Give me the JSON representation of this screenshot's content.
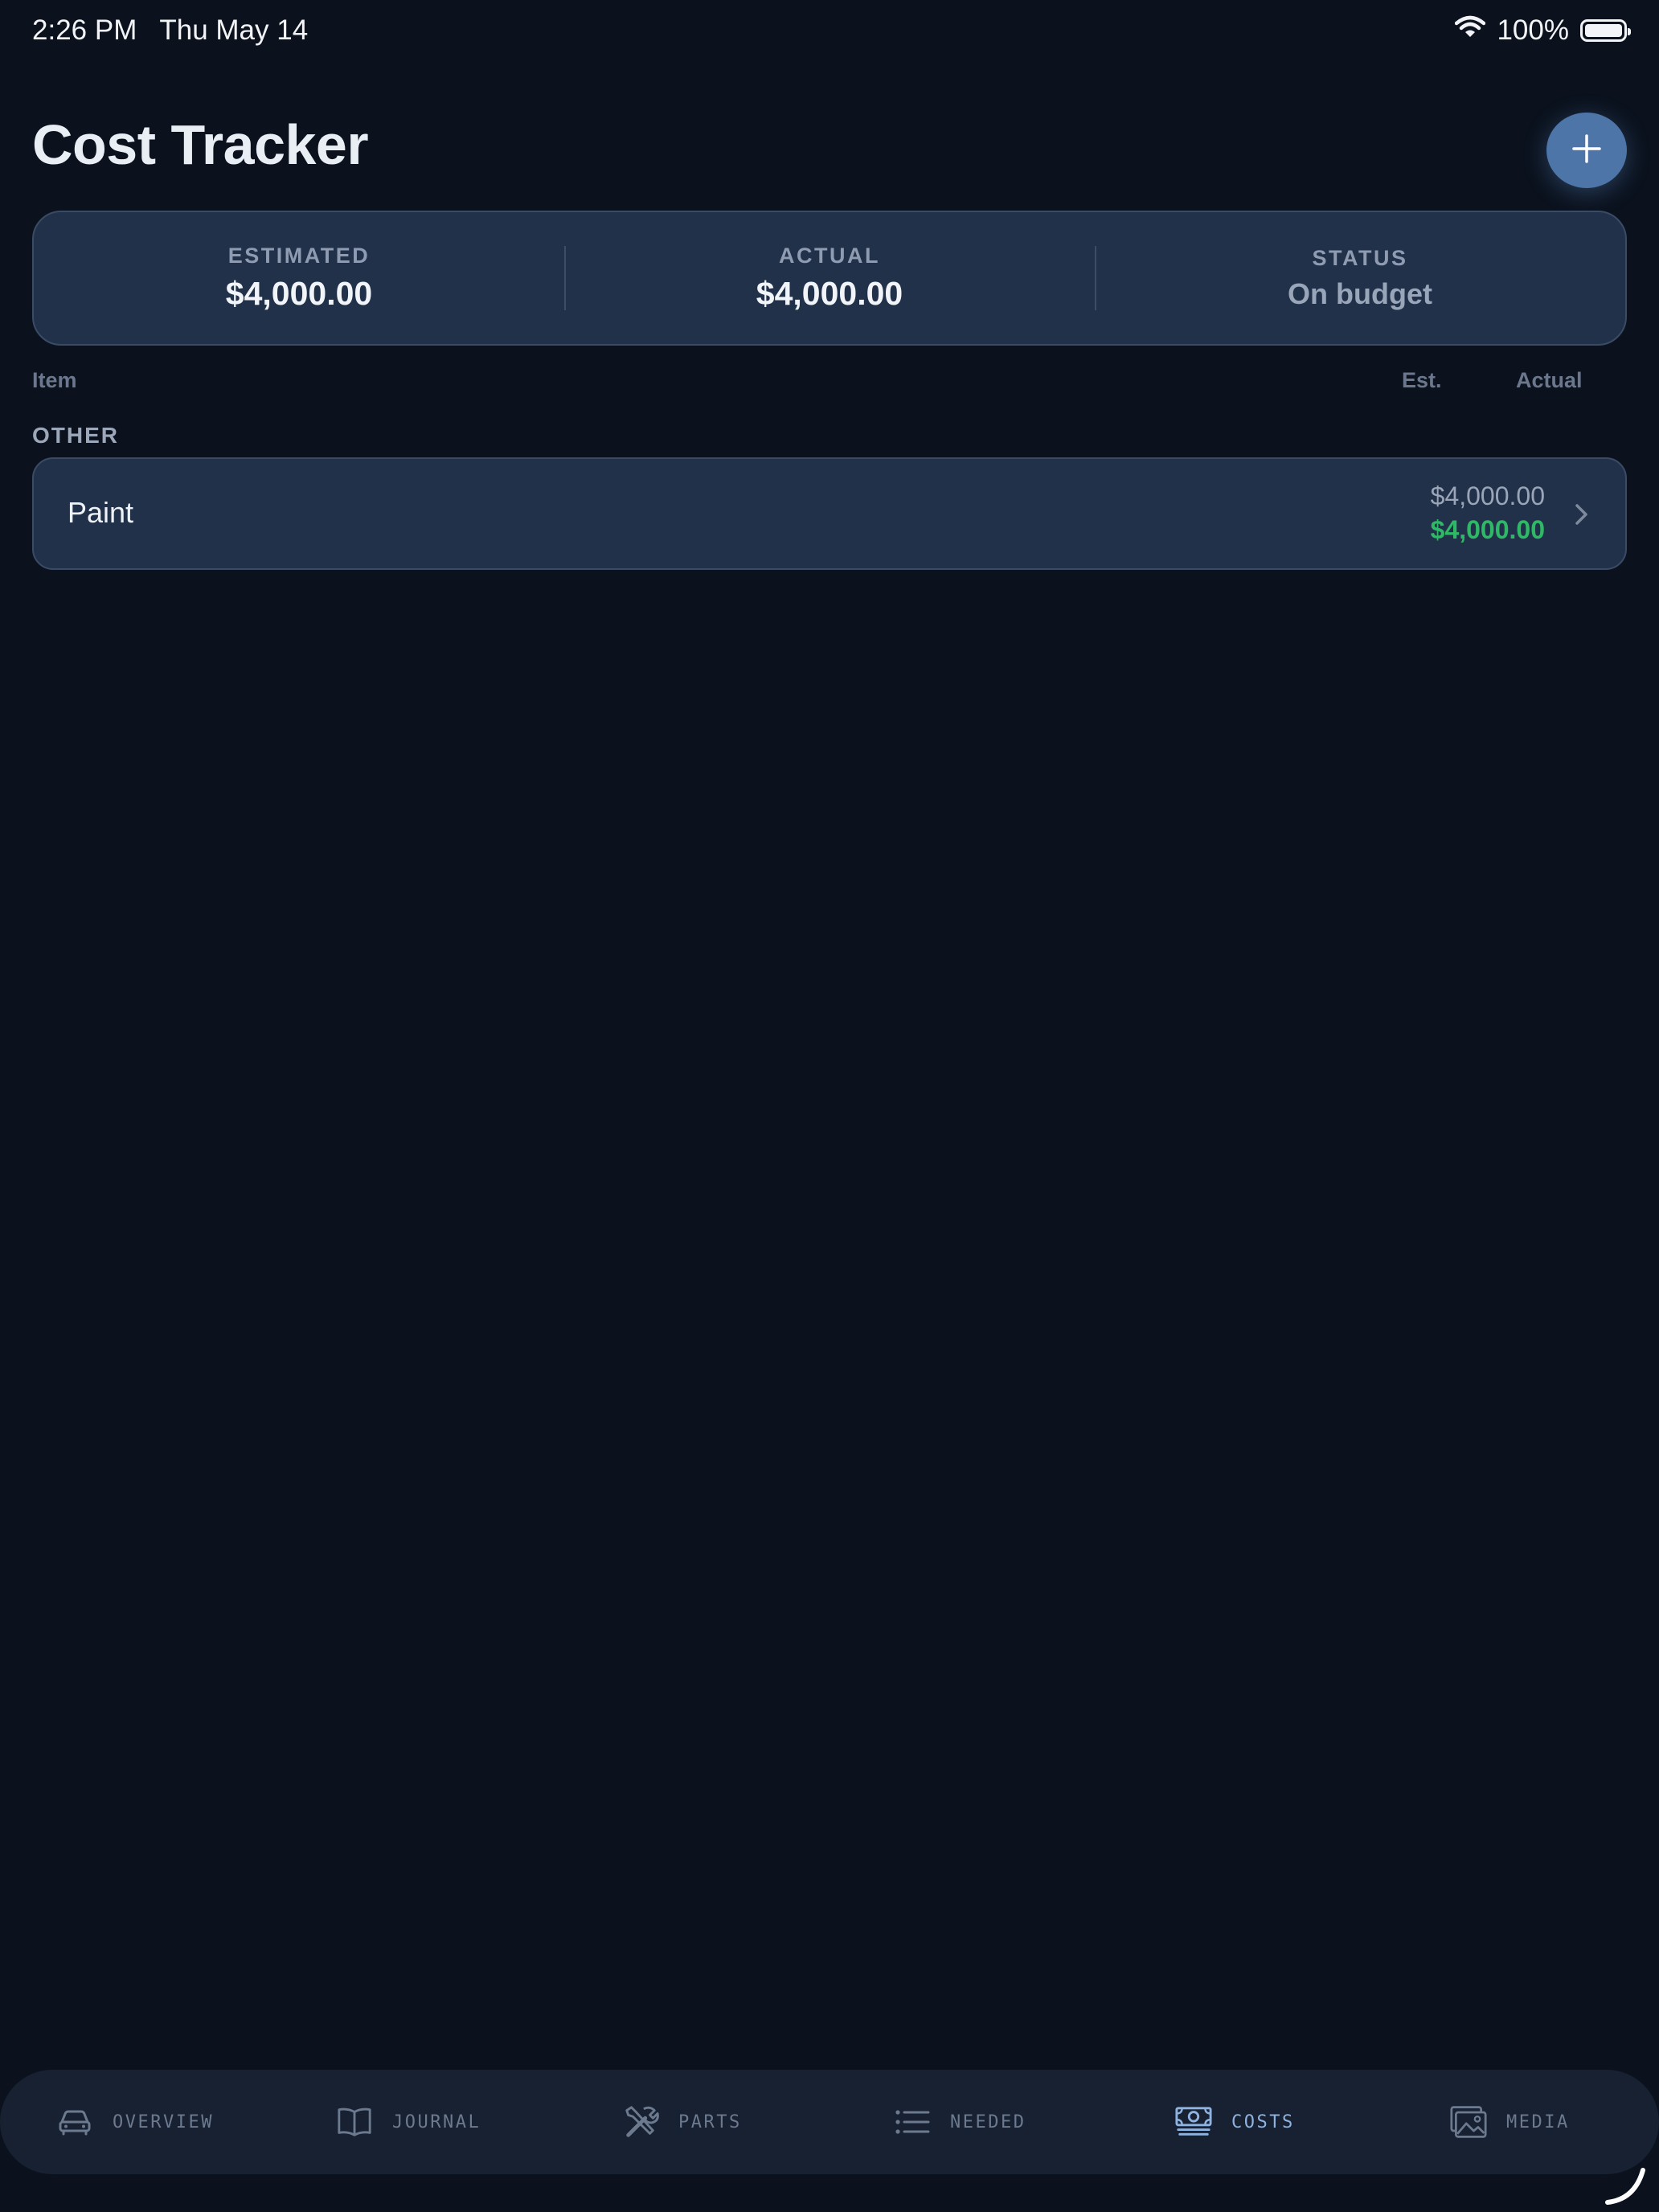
{
  "status_bar": {
    "time": "2:26 PM",
    "date": "Thu May 14",
    "battery_percent": "100%",
    "battery_level": 1.0
  },
  "header": {
    "title": "Cost Tracker",
    "add_icon": "plus-icon"
  },
  "summary": {
    "estimated_label": "ESTIMATED",
    "estimated_value": "$4,000.00",
    "actual_label": "ACTUAL",
    "actual_value": "$4,000.00",
    "status_label": "STATUS",
    "status_value": "On budget"
  },
  "columns": {
    "item": "Item",
    "est": "Est.",
    "actual": "Actual"
  },
  "sections": [
    {
      "label": "OTHER",
      "items": [
        {
          "name": "Paint",
          "estimated": "$4,000.00",
          "actual": "$4,000.00"
        }
      ]
    }
  ],
  "tabs": [
    {
      "label": "OVERVIEW",
      "icon": "car-icon",
      "active": false
    },
    {
      "label": "JOURNAL",
      "icon": "book-icon",
      "active": false
    },
    {
      "label": "PARTS",
      "icon": "tools-icon",
      "active": false
    },
    {
      "label": "NEEDED",
      "icon": "list-icon",
      "active": false
    },
    {
      "label": "COSTS",
      "icon": "banknote-icon",
      "active": true
    },
    {
      "label": "MEDIA",
      "icon": "photos-icon",
      "active": false
    }
  ],
  "colors": {
    "background": "#0b121e",
    "card": "#22314a",
    "accent": "#4d75a8",
    "positive": "#2fb865",
    "active_tab": "#8fb3e0"
  }
}
